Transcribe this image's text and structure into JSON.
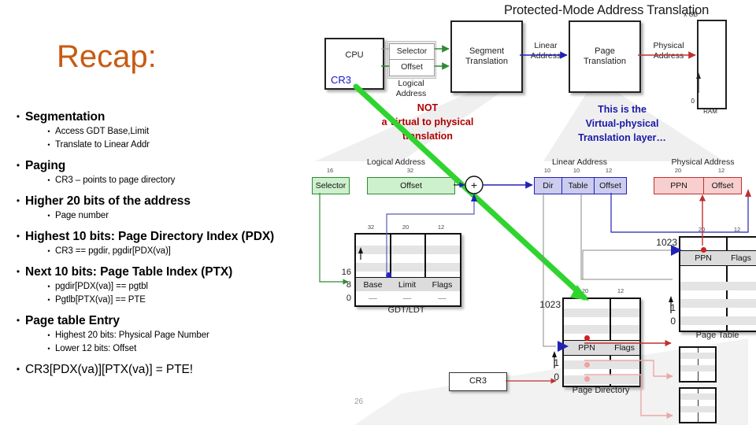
{
  "slide": {
    "page_number": "26",
    "title": "Recap:",
    "title_color": "#C75B12"
  },
  "bullets": [
    {
      "level": 1,
      "text": "Segmentation",
      "style": "bold"
    },
    {
      "level": 2,
      "text": "Access GDT Base,Limit"
    },
    {
      "level": 2,
      "text": "Translate to Linear Addr"
    },
    {
      "level": 1,
      "text": "Paging",
      "style": "bold"
    },
    {
      "level": 2,
      "text": "CR3 – points to page directory"
    },
    {
      "level": 1,
      "text": "Higher 20 bits of the address",
      "style": "bold"
    },
    {
      "level": 2,
      "text": "Page number"
    },
    {
      "level": 1,
      "text": "Highest 10 bits: Page Directory Index (PDX)",
      "style": "bold"
    },
    {
      "level": 2,
      "text": "CR3 == pgdir, pgdir[PDX(va)]"
    },
    {
      "level": 1,
      "text": "Next 10 bits: Page Table Index (PTX)",
      "style": "bold"
    },
    {
      "level": 2,
      "text": "pgdir[PDX(va)] == pgtbl"
    },
    {
      "level": 2,
      "text": "Pgtlb[PTX(va)] == PTE"
    },
    {
      "level": 1,
      "text": "Page table Entry",
      "style": "bold"
    },
    {
      "level": 2,
      "text": "Highest 20 bits: Physical Page Number"
    },
    {
      "level": 2,
      "text": "Lower 12 bits: Offset"
    },
    {
      "level": 1,
      "text": "CR3[PDX(va)][PTX(va)] = PTE!",
      "style": "plain"
    }
  ],
  "diagram": {
    "heading": "Protected-Mode Address Translation",
    "cpu": {
      "label": "CPU",
      "register": "CR3"
    },
    "selector_group": {
      "selector": "Selector",
      "offset": "Offset",
      "caption_line1": "Logical",
      "caption_line2": "Address"
    },
    "segment_translation": {
      "line1": "Segment",
      "line2": "Translation"
    },
    "page_translation": {
      "line1": "Page",
      "line2": "Translation"
    },
    "linear_arrow_label": {
      "line1": "Linear",
      "line2": "Address"
    },
    "physical_arrow_label": {
      "line1": "Physical",
      "line2": "Address"
    },
    "ram": {
      "top_label": "x GB",
      "bottom_label": "0",
      "caption": "RAM"
    },
    "annotations": {
      "red": "NOT\na virtual to physical\ntranslation",
      "red_lines": [
        "NOT",
        "a virtual to physical",
        "translation"
      ],
      "blue_lines": [
        "This is the",
        "Virtual-physical",
        "Translation layer…"
      ],
      "red_color": "#B00000",
      "blue_color": "#1A1AA8"
    },
    "logical_address": {
      "caption": "Logical Address",
      "fields": [
        {
          "name": "Selector",
          "bits": "16"
        },
        {
          "name": "Offset",
          "bits": "32"
        }
      ]
    },
    "adder": "+",
    "linear_address": {
      "caption": "Linear Address",
      "fields": [
        {
          "name": "Dir",
          "bits": "10"
        },
        {
          "name": "Table",
          "bits": "10"
        },
        {
          "name": "Offset",
          "bits": "12"
        }
      ]
    },
    "physical_address": {
      "caption": "Physical Address",
      "fields": [
        {
          "name": "PPN",
          "bits": "20"
        },
        {
          "name": "Offset",
          "bits": "12"
        }
      ]
    },
    "gdt_table": {
      "caption": "GDT/LDT",
      "columns": [
        {
          "name": "Base",
          "bits": "32"
        },
        {
          "name": "Limit",
          "bits": "20"
        },
        {
          "name": "Flags",
          "bits": "12"
        }
      ],
      "row_labels": [
        "16",
        "8",
        "0"
      ],
      "empty_row_marks": [
        "—",
        "—",
        "—"
      ]
    },
    "page_directory": {
      "caption": "Page Directory",
      "columns": [
        {
          "name": "PPN",
          "bits": "20"
        },
        {
          "name": "Flags",
          "bits": "12"
        }
      ],
      "row_labels": [
        "1023",
        "1",
        "0"
      ]
    },
    "page_table": {
      "caption": "Page Table",
      "columns": [
        {
          "name": "PPN",
          "bits": "20"
        },
        {
          "name": "Flags",
          "bits": "12"
        }
      ],
      "row_labels": [
        "1023",
        "1",
        "0"
      ]
    },
    "cr3_box": {
      "label": "CR3"
    },
    "colors": {
      "green_highlight": "#2FD42F",
      "segment_green": "#2E8B33",
      "linear_blue": "#2222B4",
      "physical_red": "#C03030"
    }
  }
}
